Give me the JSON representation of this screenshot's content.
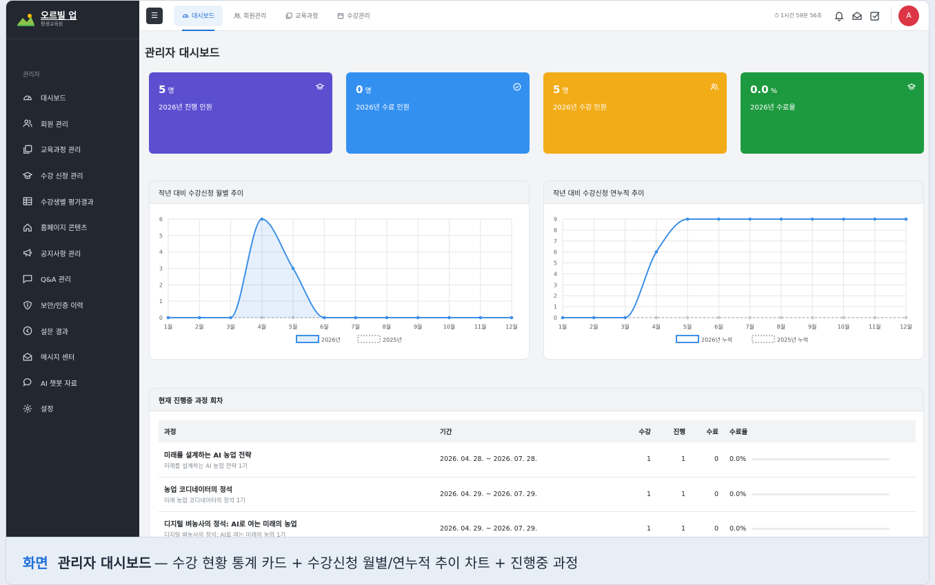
{
  "brand": {
    "name": "오르빌 업",
    "sub": "평생교육원"
  },
  "sidebar": {
    "section": "관리자",
    "items": [
      {
        "label": "대시보드",
        "icon": "dashboard-icon"
      },
      {
        "label": "회원 관리",
        "icon": "users-icon"
      },
      {
        "label": "교육과정 관리",
        "icon": "copy-icon"
      },
      {
        "label": "수강 신청 관리",
        "icon": "graduation-cap-icon"
      },
      {
        "label": "수강생별 평가결과",
        "icon": "table-icon"
      },
      {
        "label": "홈페이지 콘텐츠",
        "icon": "home-icon"
      },
      {
        "label": "공지사항 관리",
        "icon": "megaphone-icon"
      },
      {
        "label": "Q&A 관리",
        "icon": "chat-square-icon"
      },
      {
        "label": "보안/인증 이력",
        "icon": "shield-icon"
      },
      {
        "label": "설문 결과",
        "icon": "survey-icon"
      },
      {
        "label": "메시지 센터",
        "icon": "envelope-icon"
      },
      {
        "label": "AI 챗봇 자료",
        "icon": "chat-icon"
      },
      {
        "label": "설정",
        "icon": "gear-icon"
      }
    ]
  },
  "topbar": {
    "tabs": [
      {
        "label": "대시보드",
        "icon": "dashboard-icon",
        "active": true
      },
      {
        "label": "회원관리",
        "icon": "users-icon"
      },
      {
        "label": "교육과정",
        "icon": "copy-icon"
      },
      {
        "label": "수강관리",
        "icon": "calendar-icon"
      }
    ],
    "timer": "⏱ 1시간 59분 56초",
    "avatar": "A"
  },
  "page": {
    "title": "관리자 대시보드"
  },
  "cards": [
    {
      "value": "5",
      "unit": "명",
      "label": "2026년 진행 인원",
      "color": "#5b4fd0",
      "icon": "graduation-cap-icon"
    },
    {
      "value": "0",
      "unit": "명",
      "label": "2026년 수료 인원",
      "color": "#3390f0",
      "icon": "check-circle-icon"
    },
    {
      "value": "5",
      "unit": "명",
      "label": "2026년 수강 인원",
      "color": "#f2ac18",
      "icon": "users-icon"
    },
    {
      "value": "0.0",
      "unit": "%",
      "label": "2026년 수료율",
      "color": "#1d9a3f",
      "icon": "graduation-cap-icon"
    }
  ],
  "chart_data": [
    {
      "type": "line",
      "title": "작년 대비 수강신청 월별 추이",
      "categories": [
        "1월",
        "2월",
        "3월",
        "4월",
        "5월",
        "6월",
        "7월",
        "8월",
        "9월",
        "10월",
        "11월",
        "12월"
      ],
      "ylim": [
        0,
        6
      ],
      "yticks": [
        0,
        1,
        2,
        3,
        4,
        5,
        6
      ],
      "series": [
        {
          "name": "2026년",
          "values": [
            0,
            0,
            0,
            6,
            3,
            0,
            0,
            0,
            0,
            0,
            0,
            0
          ],
          "color": "#3a8ee6",
          "fill": true
        },
        {
          "name": "2025년",
          "values": [
            0,
            0,
            0,
            0,
            0,
            0,
            0,
            0,
            0,
            0,
            0,
            0
          ],
          "color": "#b5b9bf",
          "dashed": true
        }
      ],
      "grid": true,
      "legend": "bottom"
    },
    {
      "type": "line",
      "title": "작년 대비 수강신청 연누적 추이",
      "categories": [
        "1월",
        "2월",
        "3월",
        "4월",
        "5월",
        "6월",
        "7월",
        "8월",
        "9월",
        "10월",
        "11월",
        "12월"
      ],
      "ylim": [
        0,
        9
      ],
      "yticks": [
        0,
        1,
        2,
        3,
        4,
        5,
        6,
        7,
        8,
        9
      ],
      "series": [
        {
          "name": "2026년 누적",
          "values": [
            0,
            0,
            0,
            6,
            9,
            9,
            9,
            9,
            9,
            9,
            9,
            9
          ],
          "color": "#3a8ee6",
          "fill": false
        },
        {
          "name": "2025년 누적",
          "values": [
            0,
            0,
            0,
            0,
            0,
            0,
            0,
            0,
            0,
            0,
            0,
            0
          ],
          "color": "#b5b9bf",
          "dashed": true
        }
      ],
      "grid": true,
      "legend": "bottom"
    }
  ],
  "table": {
    "title": "현재 진행중 과정 회차",
    "headers": [
      "과정",
      "기간",
      "수강",
      "진행",
      "수료",
      "수료율"
    ],
    "rows": [
      {
        "title": "미래를 설계하는 AI 농업 전략",
        "sub": "미래를 설계하는 AI 농업 전략 1기",
        "period": "2026. 04. 28. ~ 2026. 07. 28.",
        "enrolled": "1",
        "progress": "1",
        "completed": "0",
        "rate": "0.0%",
        "rate_value": 0
      },
      {
        "title": "농업 코디네이터의 정석",
        "sub": "미래 농업 코디네이터의 정석 1기",
        "period": "2026. 04. 29. ~ 2026. 07. 29.",
        "enrolled": "1",
        "progress": "1",
        "completed": "0",
        "rate": "0.0%",
        "rate_value": 0
      },
      {
        "title": "디지털 벼농사의 정석: AI로 여는 미래의 농업",
        "sub": "디지털 벼농사의 정석: AI로 여는 미래의 농업 1기",
        "period": "2026. 04. 29. ~ 2026. 07. 29.",
        "enrolled": "1",
        "progress": "1",
        "completed": "0",
        "rate": "0.0%",
        "rate_value": 0
      }
    ]
  },
  "caption": {
    "kind": "화면",
    "title": "관리자 대시보드",
    "desc": "— 수강 현황 통계 카드 + 수강신청 월별/연누적 추이 차트 + 진행중 과정"
  }
}
